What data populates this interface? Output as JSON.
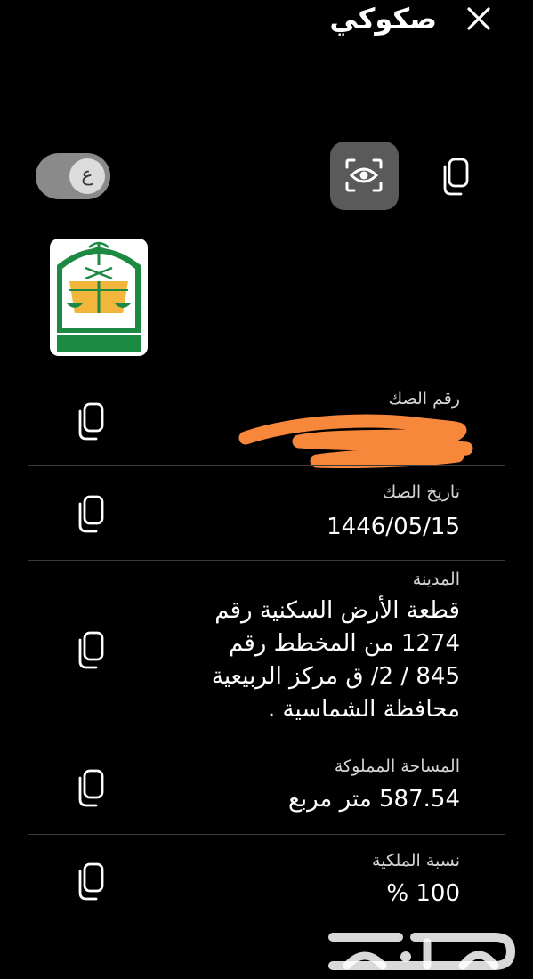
{
  "header": {
    "title": "صكوكي"
  },
  "icons": {
    "close": "close-icon",
    "eye": "eye-scan-icon",
    "copy": "copy-icon"
  },
  "toggle": {
    "label": "ع",
    "state": "on"
  },
  "colors": {
    "background": "#000000",
    "redaction": "#f7873a",
    "logo_green": "#1d8a43",
    "logo_gold": "#f2b63d"
  },
  "logo": {
    "text": "وزارة العدل"
  },
  "fields": [
    {
      "label": "رقم الصك",
      "value": ""
    },
    {
      "label": "تاريخ الصك",
      "value": "1446/05/15"
    },
    {
      "label": "المدينة",
      "value": "قطعة الأرض السكنية  رقم\n1274 من المخطط رقم\n845 / 2/ ق مركز الربيعية\nمحافظة الشماسية ."
    },
    {
      "label": "المساحة المملوكة",
      "value": "587.54 متر مربع"
    },
    {
      "label": "نسبة الملكية",
      "value": "100 %"
    }
  ],
  "watermark": {
    "text": "حراج"
  }
}
